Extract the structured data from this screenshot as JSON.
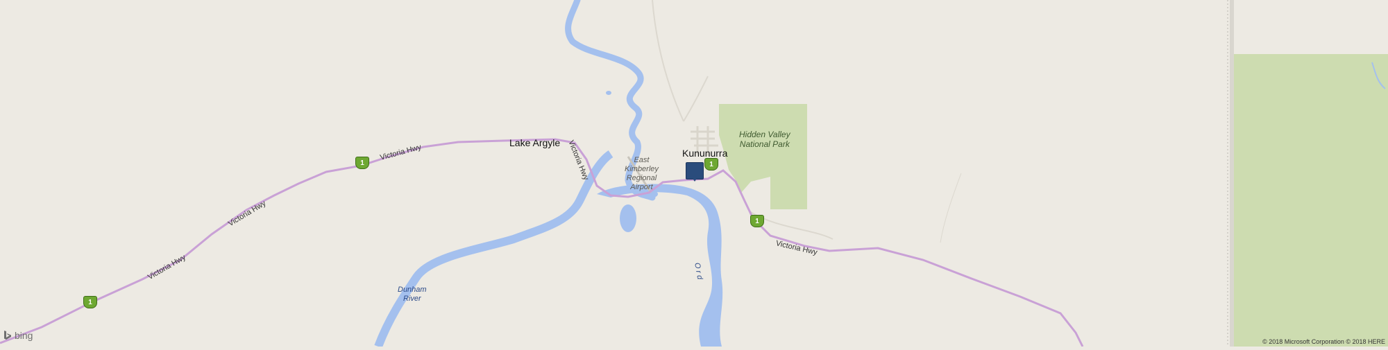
{
  "map": {
    "places": {
      "kununurra": "Kununurra",
      "lake_argyle": "Lake Argyle"
    },
    "park": {
      "line1": "Hidden Valley",
      "line2": "National Park"
    },
    "airport": {
      "line1": "East",
      "line2": "Kimberley",
      "line3": "Regional",
      "line4": "Airport"
    },
    "water": {
      "dunham_line1": "Dunham",
      "dunham_line2": "River",
      "ord": "O r d"
    },
    "roads": {
      "victoria_hwy": "Victoria Hwy",
      "shield_number": "1"
    },
    "attribution": {
      "brand": "bing",
      "copyright": "© 2018 Microsoft Corporation © 2018 HERE"
    },
    "colors": {
      "land": "#edeae3",
      "water": "#a4c0ee",
      "park": "#cddcb0",
      "highway": "#c9a1d6",
      "marker": "#2a4c7c",
      "shield": "#6ea832"
    }
  }
}
